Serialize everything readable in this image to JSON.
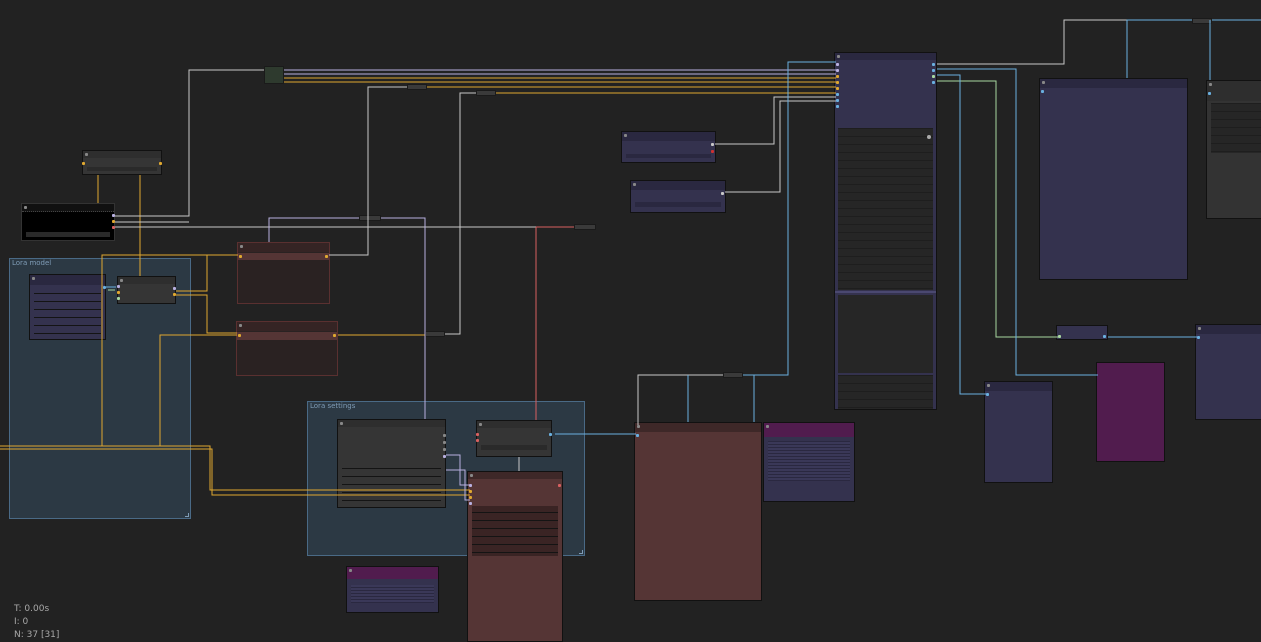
{
  "app": {
    "name": "node-graph-canvas"
  },
  "groups": {
    "lora_model": {
      "title": "Lora model"
    },
    "lora_settings": {
      "title": "Lora settings"
    }
  },
  "stats": {
    "time": "T: 0.00s",
    "iterations": "I: 0",
    "node_count": "N: 37 [31]"
  },
  "colors": {
    "canvas": "#222222",
    "wire_yellow": "#e0a830",
    "wire_blue": "#6ab0e0",
    "wire_white": "#c8c8c8",
    "wire_green": "#a8d8a0",
    "wire_red": "#d86060",
    "wire_lavender": "#b8b0e0",
    "node_purple": "#34324e",
    "node_red": "#553535",
    "node_magenta": "#511c4e",
    "node_gray": "#333333"
  }
}
